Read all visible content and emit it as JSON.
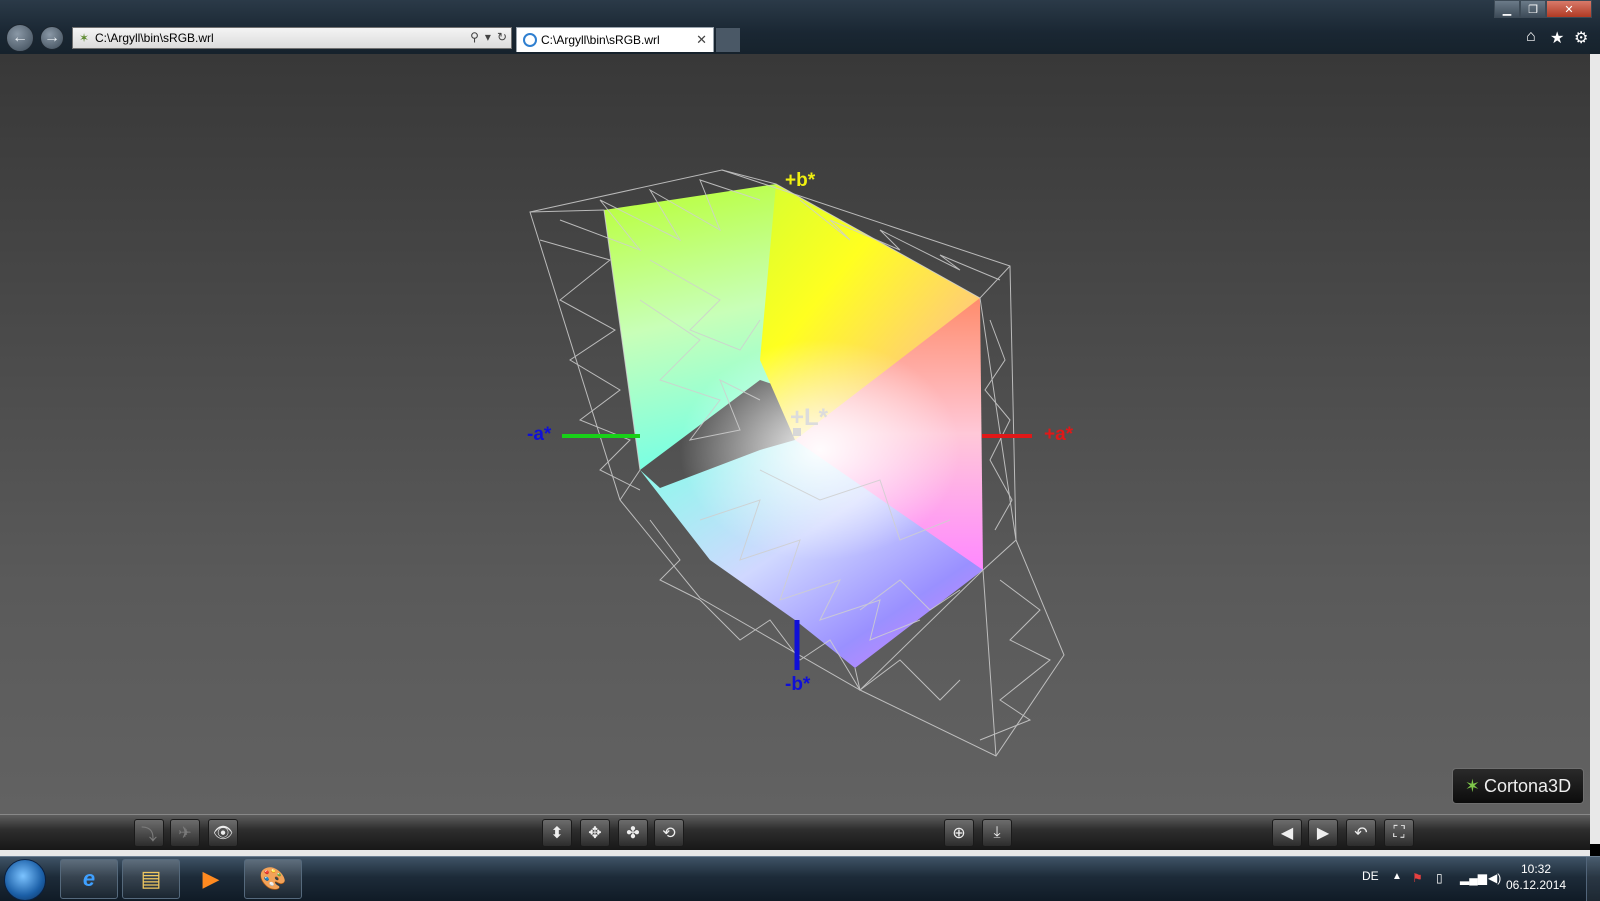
{
  "browser": {
    "address": "C:\\Argyll\\bin\\sRGB.wrl",
    "tab_title": "C:\\Argyll\\bin\\sRGB.wrl",
    "tab_close": "✕",
    "back_icon": "back-arrow-icon",
    "forward_icon": "forward-arrow-icon",
    "window_controls": {
      "minimize": "▁",
      "maximize": "❐",
      "close": "✕"
    },
    "right_tools": {
      "home": "⌂",
      "favorites": "★",
      "settings": "⚙"
    }
  },
  "viewer": {
    "axes": {
      "plus_b": "+b*",
      "minus_b": "-b*",
      "plus_a": "+a*",
      "minus_a": "-a*",
      "plus_l": "+L*"
    },
    "axis_colors": {
      "a_negative": "#18d018",
      "a_positive": "#e01818",
      "b_negative": "#1010d8",
      "b_positive": "#f0f010",
      "l": "#d8d8d8"
    },
    "logo": "Cortona3D"
  },
  "toolbar": {
    "left": [
      {
        "name": "plan-button",
        "glyph": "⤵",
        "dim": true
      },
      {
        "name": "fly-button",
        "glyph": "✈",
        "dim": true
      },
      {
        "name": "study-button",
        "glyph": "👁",
        "dim": false
      }
    ],
    "center": [
      {
        "name": "slide-button",
        "glyph": "⬍"
      },
      {
        "name": "pan-button",
        "glyph": "✥"
      },
      {
        "name": "turn-button",
        "glyph": "✤"
      },
      {
        "name": "roll-button",
        "glyph": "⟲"
      }
    ],
    "mid": [
      {
        "name": "goto-button",
        "glyph": "⊕"
      },
      {
        "name": "align-button",
        "glyph": "⤓"
      }
    ],
    "right": [
      {
        "name": "prev-viewpoint-button",
        "glyph": "◀"
      },
      {
        "name": "next-viewpoint-button",
        "glyph": "▶"
      },
      {
        "name": "restore-button",
        "glyph": "↶"
      },
      {
        "name": "fit-button",
        "glyph": "⛶"
      }
    ]
  },
  "taskbar": {
    "language": "DE",
    "time": "10:32",
    "date": "06.12.2014",
    "items": [
      {
        "name": "ie-taskbar-icon",
        "glyph": "e"
      },
      {
        "name": "explorer-taskbar-icon",
        "glyph": "▤"
      },
      {
        "name": "media-player-taskbar-icon",
        "glyph": "▶"
      },
      {
        "name": "paint-taskbar-icon",
        "glyph": "🎨"
      }
    ]
  }
}
